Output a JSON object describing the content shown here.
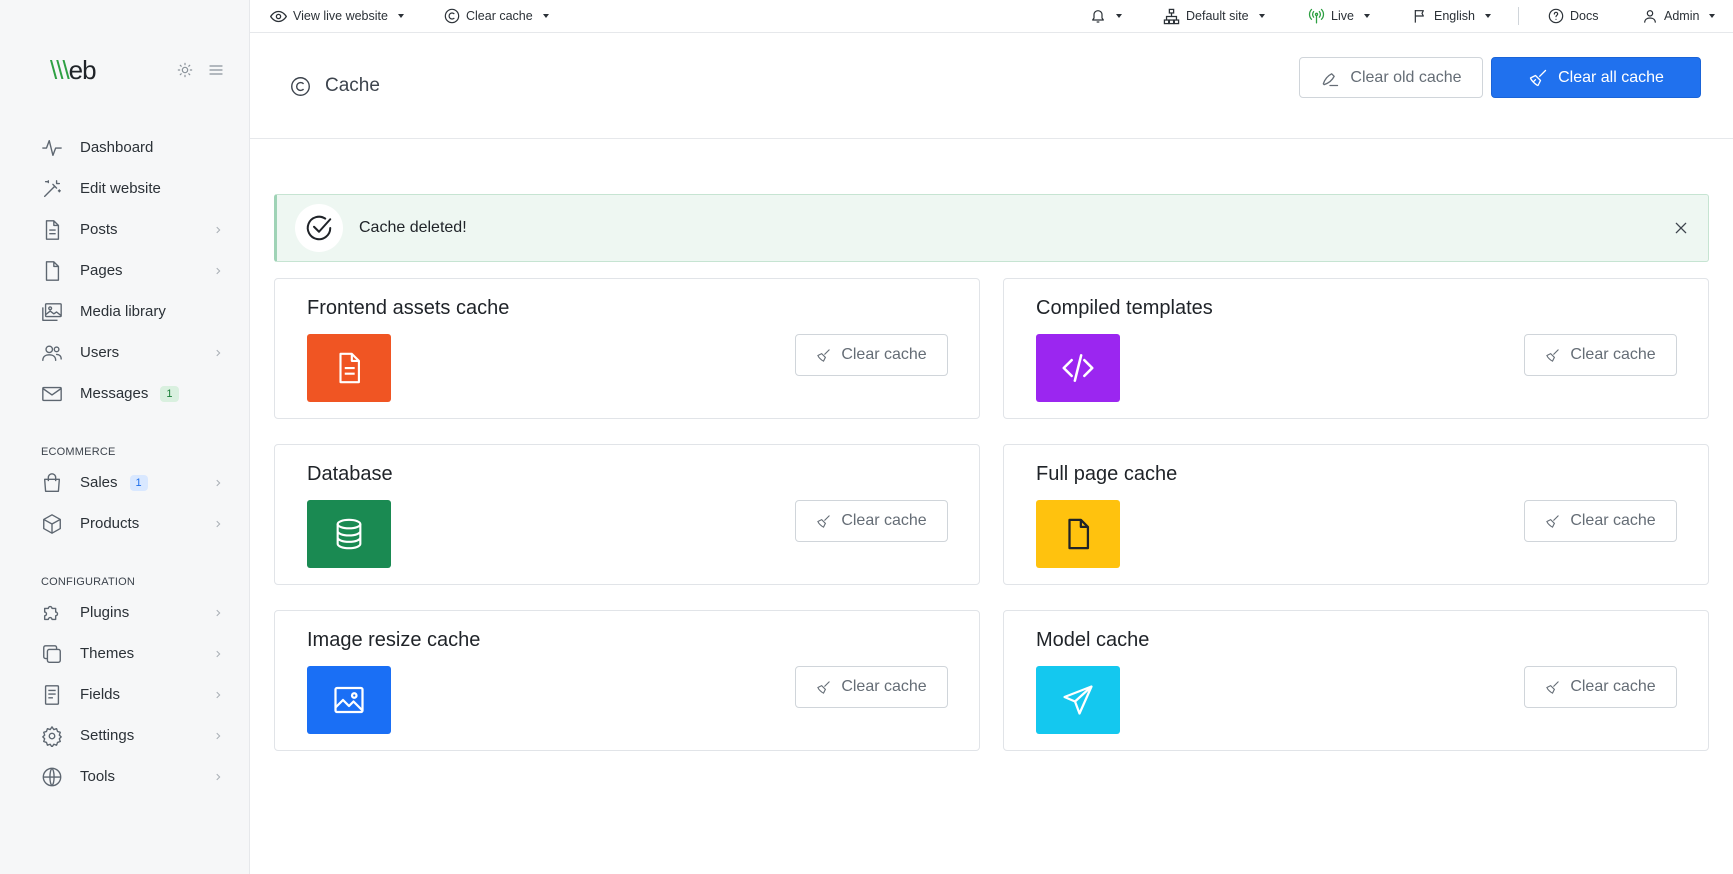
{
  "brand": {
    "logo_accent": "\\\\\\",
    "logo_rest": "eb"
  },
  "colors": {
    "primary": "#2071ee",
    "success_bg": "#eef7f2",
    "sidebar_bg": "#f6f7f8"
  },
  "sidebar": {
    "main_items": [
      {
        "label": "Dashboard",
        "icon": "activity-icon",
        "chevron": false
      },
      {
        "label": "Edit website",
        "icon": "magic-wand-icon",
        "chevron": false
      },
      {
        "label": "Posts",
        "icon": "document-icon",
        "chevron": true
      },
      {
        "label": "Pages",
        "icon": "page-icon",
        "chevron": true
      },
      {
        "label": "Media library",
        "icon": "images-icon",
        "chevron": false
      },
      {
        "label": "Users",
        "icon": "users-icon",
        "chevron": true
      },
      {
        "label": "Messages",
        "icon": "mail-icon",
        "chevron": false,
        "badge": "1"
      }
    ],
    "ecommerce_heading": "ECOMMERCE",
    "ecommerce_items": [
      {
        "label": "Sales",
        "icon": "shopping-bag-icon",
        "chevron": true,
        "badge": "1"
      },
      {
        "label": "Products",
        "icon": "box-icon",
        "chevron": true
      }
    ],
    "config_heading": "CONFIGURATION",
    "config_items": [
      {
        "label": "Plugins",
        "icon": "puzzle-icon",
        "chevron": true
      },
      {
        "label": "Themes",
        "icon": "copy-icon",
        "chevron": true
      },
      {
        "label": "Fields",
        "icon": "form-icon",
        "chevron": true
      },
      {
        "label": "Settings",
        "icon": "gear-icon",
        "chevron": true
      },
      {
        "label": "Tools",
        "icon": "globe-icon",
        "chevron": true
      }
    ]
  },
  "topbar": {
    "view_live": "View live website",
    "clear_cache": "Clear cache",
    "site": "Default site",
    "mode": "Live",
    "language": "English",
    "docs": "Docs",
    "user": "Admin"
  },
  "page": {
    "title": "Cache",
    "clear_old_label": "Clear old cache",
    "clear_all_label": "Clear all cache"
  },
  "alert": {
    "message": "Cache deleted!"
  },
  "cards": [
    {
      "title": "Frontend assets cache",
      "button": "Clear cache",
      "color": "#f05523",
      "icon": "file-text-icon"
    },
    {
      "title": "Compiled templates",
      "button": "Clear cache",
      "color": "#9b26f0",
      "icon": "code-icon"
    },
    {
      "title": "Database",
      "button": "Clear cache",
      "color": "#1a8a52",
      "icon": "database-icon"
    },
    {
      "title": "Full page cache",
      "button": "Clear cache",
      "color": "#ffc20e",
      "icon": "file-icon"
    },
    {
      "title": "Image resize cache",
      "button": "Clear cache",
      "color": "#1a6ff5",
      "icon": "image-icon"
    },
    {
      "title": "Model cache",
      "button": "Clear cache",
      "color": "#14c8ef",
      "icon": "send-icon"
    }
  ]
}
